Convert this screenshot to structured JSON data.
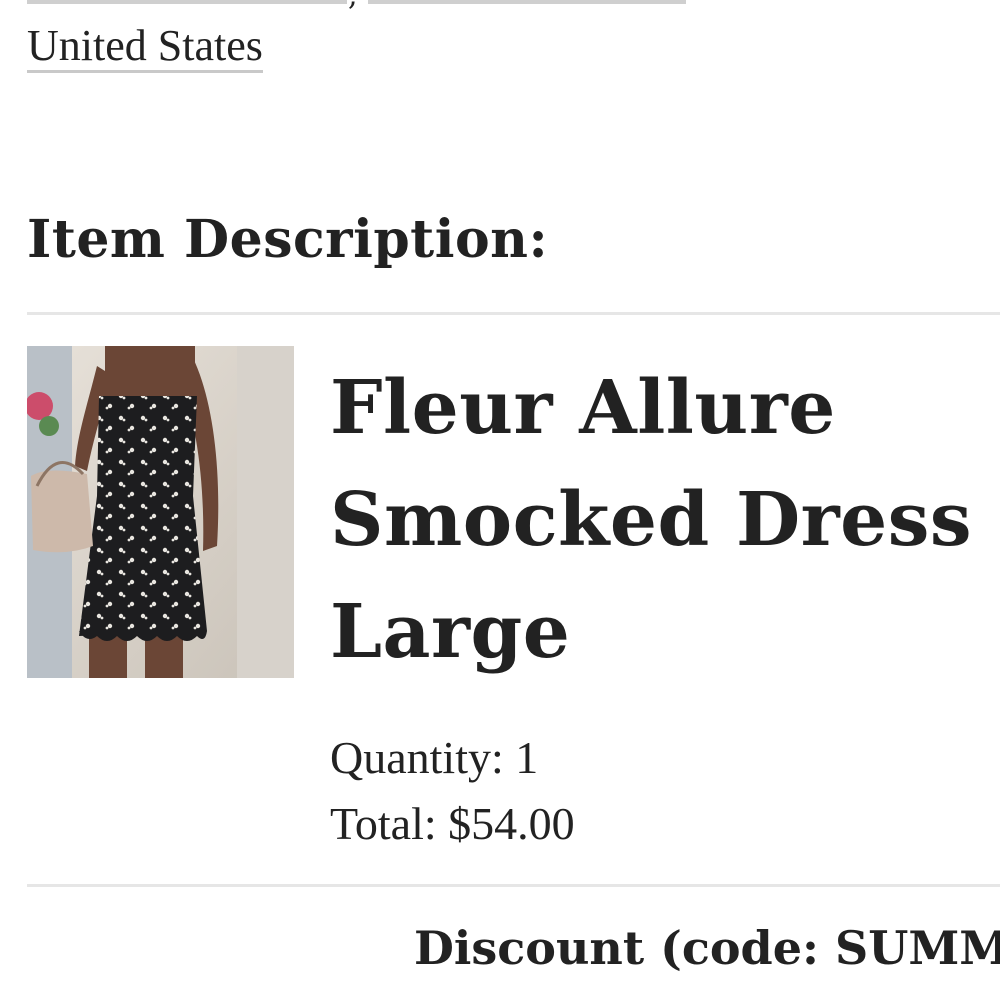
{
  "address": {
    "country": "United States"
  },
  "item_section": {
    "heading": "Item Description:"
  },
  "item": {
    "name_lines": [
      "Fleur Allure",
      "Smocked Dress",
      "Large"
    ],
    "quantity_text": "Quantity: 1",
    "total_text": "Total: $54.00"
  },
  "summary": {
    "discount_text": "Discount (code: SUMM"
  }
}
